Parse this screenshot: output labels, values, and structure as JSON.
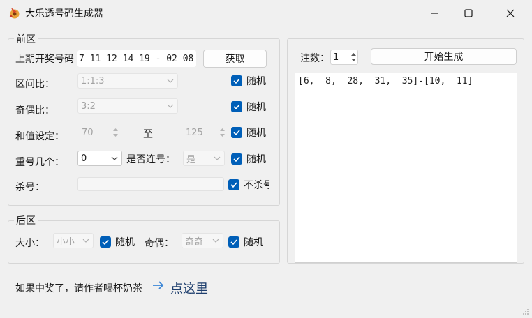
{
  "window": {
    "title": "大乐透号码生成器",
    "icons": {
      "app": "rocket-app-icon",
      "minimize": "minimize-icon",
      "maximize": "maximize-icon",
      "close": "close-icon"
    }
  },
  "front": {
    "group_label": "前区",
    "last_draw_label": "上期开奖号码",
    "last_draw_value": "7 11 12 14 19 - 02 08",
    "fetch_button": "获取",
    "zone_ratio_label": "区间比：",
    "zone_ratio_value": "1:1:3",
    "odd_even_label": "奇偶比：",
    "odd_even_value": "3:2",
    "sum_label": "和值设定：",
    "sum_min": "70",
    "sum_to": "至",
    "sum_max": "125",
    "repeat_label": "重号几个：",
    "repeat_value": "0",
    "consecutive_label": "是否连号：",
    "consecutive_value": "是",
    "kill_label": "杀号：",
    "kill_value": "",
    "random_label": "随机",
    "no_kill_label": "不杀号"
  },
  "back": {
    "group_label": "后区",
    "size_label": "大小：",
    "size_value": "小小",
    "parity_label": "奇偶：",
    "parity_value": "奇奇",
    "random_label": "随机"
  },
  "generator": {
    "count_label": "注数：",
    "count_value": "1",
    "start_button": "开始生成",
    "output": "[6,  8,  28,  31,  35]-[10,  11]"
  },
  "footer": {
    "message": "如果中奖了，请作者喝杯奶茶",
    "link_text": "点这里",
    "arrow_icon": "arrow-right-icon"
  },
  "colors": {
    "accent": "#005fb8",
    "arrow": "#3b86d6",
    "link": "#1f3f6e"
  }
}
